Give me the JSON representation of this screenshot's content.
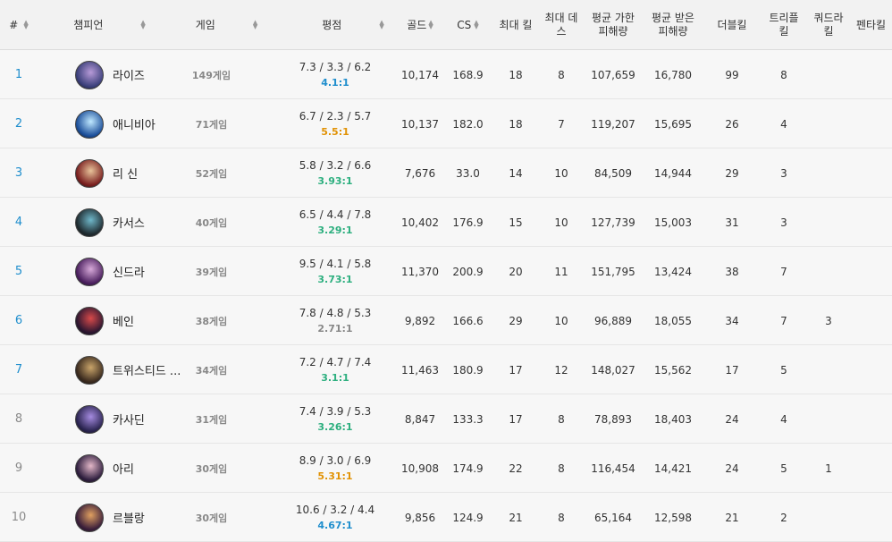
{
  "headers": {
    "rank": "#",
    "champion": "챔피언",
    "games": "게임",
    "rating": "평점",
    "gold": "골드",
    "cs": "CS",
    "max_kill": "최대 킬",
    "max_death": "최대 데스",
    "avg_dmg_dealt": "평균 가한 피해량",
    "avg_dmg_taken": "평균 받은 피해량",
    "double": "더블킬",
    "triple": "트리플 킬",
    "quadra": "쿼드라 킬",
    "penta": "펜타킬"
  },
  "sort_glyphs": {
    "up": "▲",
    "down": "▼"
  },
  "colors": {
    "rank_blue": "#1f8ecd",
    "rank_gray": "#8a8a8a",
    "kda_blue": "#1f8ecd",
    "kda_green": "#2daf7f",
    "kda_orange": "#e19205",
    "kda_gray": "#888888"
  },
  "rows": [
    {
      "rank": "1",
      "champion": "라이즈",
      "games": "149게임",
      "kda": "7.3 / 3.3 / 6.2",
      "ratio": "4.1:1",
      "ratio_color": "blue",
      "gold": "10,174",
      "cs": "168.9",
      "max_kill": "18",
      "max_death": "8",
      "dealt": "107,659",
      "taken": "16,780",
      "double": "99",
      "triple": "8",
      "quadra": "",
      "penta": "",
      "avatar": [
        "#3a3f7a",
        "#b79ad8"
      ]
    },
    {
      "rank": "2",
      "champion": "애니비아",
      "games": "71게임",
      "kda": "6.7 / 2.3 / 5.7",
      "ratio": "5.5:1",
      "ratio_color": "orange",
      "gold": "10,137",
      "cs": "182.0",
      "max_kill": "18",
      "max_death": "7",
      "dealt": "119,207",
      "taken": "15,695",
      "double": "26",
      "triple": "4",
      "quadra": "",
      "penta": "",
      "avatar": [
        "#1c4f9a",
        "#bfe8ff"
      ]
    },
    {
      "rank": "3",
      "champion": "리 신",
      "games": "52게임",
      "kda": "5.8 / 3.2 / 6.6",
      "ratio": "3.93:1",
      "ratio_color": "green",
      "gold": "7,676",
      "cs": "33.0",
      "max_kill": "14",
      "max_death": "10",
      "dealt": "84,509",
      "taken": "14,944",
      "double": "29",
      "triple": "3",
      "quadra": "",
      "penta": "",
      "avatar": [
        "#7a1f1f",
        "#e8c39a"
      ]
    },
    {
      "rank": "4",
      "champion": "카서스",
      "games": "40게임",
      "kda": "6.5 / 4.4 / 7.8",
      "ratio": "3.29:1",
      "ratio_color": "green",
      "gold": "10,402",
      "cs": "176.9",
      "max_kill": "15",
      "max_death": "10",
      "dealt": "127,739",
      "taken": "15,003",
      "double": "31",
      "triple": "3",
      "quadra": "",
      "penta": "",
      "avatar": [
        "#1f2b30",
        "#6fb7c9"
      ]
    },
    {
      "rank": "5",
      "champion": "신드라",
      "games": "39게임",
      "kda": "9.5 / 4.1 / 5.8",
      "ratio": "3.73:1",
      "ratio_color": "green",
      "gold": "11,370",
      "cs": "200.9",
      "max_kill": "20",
      "max_death": "11",
      "dealt": "151,795",
      "taken": "13,424",
      "double": "38",
      "triple": "7",
      "quadra": "",
      "penta": "",
      "avatar": [
        "#4a1f5e",
        "#d7a9d9"
      ]
    },
    {
      "rank": "6",
      "champion": "베인",
      "games": "38게임",
      "kda": "7.8 / 4.8 / 5.3",
      "ratio": "2.71:1",
      "ratio_color": "gray",
      "gold": "9,892",
      "cs": "166.6",
      "max_kill": "29",
      "max_death": "10",
      "dealt": "96,889",
      "taken": "18,055",
      "double": "34",
      "triple": "7",
      "quadra": "3",
      "penta": "",
      "avatar": [
        "#2b1630",
        "#d84a4a"
      ]
    },
    {
      "rank": "7",
      "champion": "트위스티드 ...",
      "games": "34게임",
      "kda": "7.2 / 4.7 / 7.4",
      "ratio": "3.1:1",
      "ratio_color": "green",
      "gold": "11,463",
      "cs": "180.9",
      "max_kill": "17",
      "max_death": "12",
      "dealt": "148,027",
      "taken": "15,562",
      "double": "17",
      "triple": "5",
      "quadra": "",
      "penta": "",
      "avatar": [
        "#3a2a1e",
        "#c9a46a"
      ]
    },
    {
      "rank": "8",
      "champion": "카사딘",
      "games": "31게임",
      "kda": "7.4 / 3.9 / 5.3",
      "ratio": "3.26:1",
      "ratio_color": "green",
      "gold": "8,847",
      "cs": "133.3",
      "max_kill": "17",
      "max_death": "8",
      "dealt": "78,893",
      "taken": "18,403",
      "double": "24",
      "triple": "4",
      "quadra": "",
      "penta": "",
      "avatar": [
        "#2a2450",
        "#a58be0"
      ]
    },
    {
      "rank": "9",
      "champion": "아리",
      "games": "30게임",
      "kda": "8.9 / 3.0 / 6.9",
      "ratio": "5.31:1",
      "ratio_color": "orange",
      "gold": "10,908",
      "cs": "174.9",
      "max_kill": "22",
      "max_death": "8",
      "dealt": "116,454",
      "taken": "14,421",
      "double": "24",
      "triple": "5",
      "quadra": "1",
      "penta": "",
      "avatar": [
        "#2e1e3e",
        "#e3b7c8"
      ]
    },
    {
      "rank": "10",
      "champion": "르블랑",
      "games": "30게임",
      "kda": "10.6 / 3.2 / 4.4",
      "ratio": "4.67:1",
      "ratio_color": "blue",
      "gold": "9,856",
      "cs": "124.9",
      "max_kill": "21",
      "max_death": "8",
      "dealt": "65,164",
      "taken": "12,598",
      "double": "21",
      "triple": "2",
      "quadra": "",
      "penta": "",
      "avatar": [
        "#3a1e3a",
        "#e0a060"
      ]
    }
  ]
}
